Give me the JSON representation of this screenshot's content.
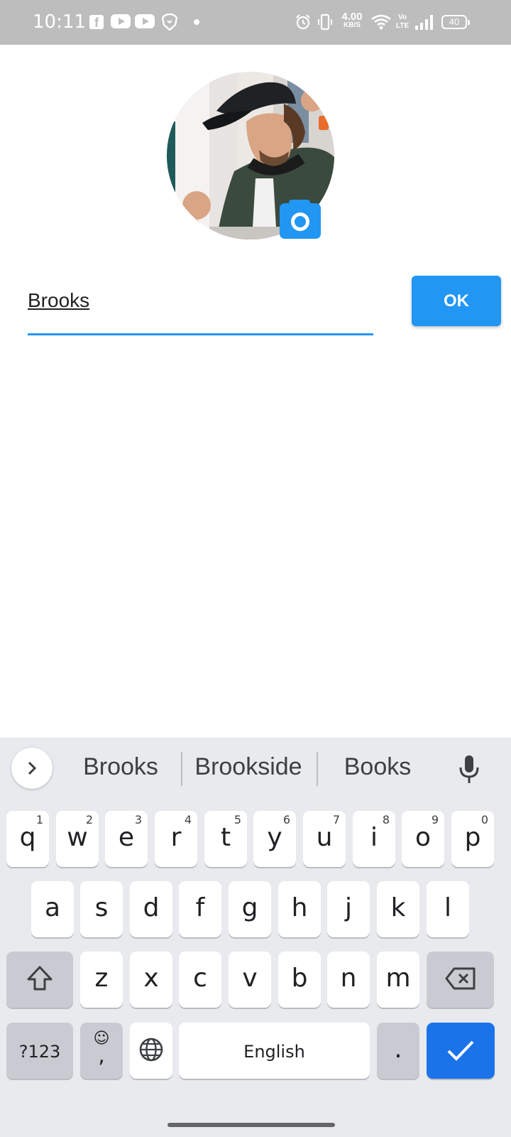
{
  "status_bar": {
    "time": "10:11",
    "network_speed_value": "4.00",
    "network_speed_unit": "KB/S",
    "volte_line1": "Vo",
    "volte_line2": "LTE",
    "battery": "40",
    "icons": [
      "facebook-icon",
      "youtube-icon",
      "youtube-icon",
      "brave-icon",
      "dot-icon",
      "alarm-icon",
      "vibrate-icon",
      "wifi-icon",
      "volte-icon",
      "signal-icon",
      "battery-icon"
    ]
  },
  "profile": {
    "name_value": "Brooks",
    "ok_label": "OK",
    "accent_color": "#2196f3"
  },
  "keyboard": {
    "suggestions": [
      "Brooks",
      "Brookside",
      "Books"
    ],
    "row1": [
      {
        "label": "q",
        "hint": "1"
      },
      {
        "label": "w",
        "hint": "2"
      },
      {
        "label": "e",
        "hint": "3"
      },
      {
        "label": "r",
        "hint": "4"
      },
      {
        "label": "t",
        "hint": "5"
      },
      {
        "label": "y",
        "hint": "6"
      },
      {
        "label": "u",
        "hint": "7"
      },
      {
        "label": "i",
        "hint": "8"
      },
      {
        "label": "o",
        "hint": "9"
      },
      {
        "label": "p",
        "hint": "0"
      }
    ],
    "row2": [
      "a",
      "s",
      "d",
      "f",
      "g",
      "h",
      "j",
      "k",
      "l"
    ],
    "row3": [
      "z",
      "x",
      "c",
      "v",
      "b",
      "n",
      "m"
    ],
    "symbols_label": "?123",
    "emoji_label": "☺",
    "comma_label": ",",
    "space_label": "English",
    "period_label": ".",
    "enter_color": "#1a73e8"
  }
}
